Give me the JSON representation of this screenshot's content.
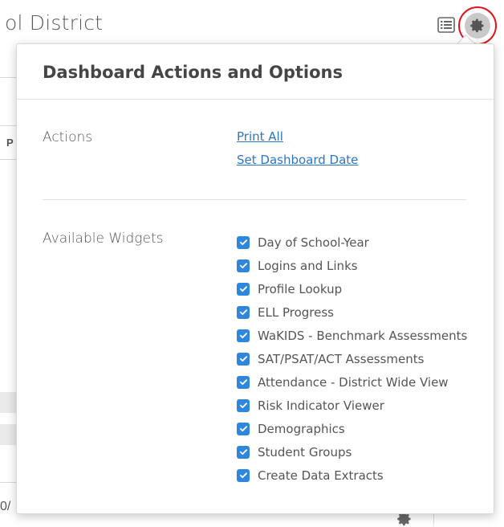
{
  "page": {
    "title_fragment": "ol District",
    "left_edge_letter": "P",
    "bottom_text_fragment": "0/"
  },
  "header": {
    "list_view_icon": "list-view-icon",
    "settings_icon": "gear-icon"
  },
  "popover": {
    "title": "Dashboard Actions and Options",
    "actions": {
      "label": "Actions",
      "links": [
        "Print All",
        "Set Dashboard Date"
      ]
    },
    "widgets": {
      "label": "Available Widgets",
      "items": [
        {
          "label": "Day of School-Year",
          "checked": true
        },
        {
          "label": "Logins and Links",
          "checked": true
        },
        {
          "label": "Profile Lookup",
          "checked": true
        },
        {
          "label": "ELL Progress",
          "checked": true
        },
        {
          "label": "WaKIDS - Benchmark Assessments",
          "checked": true
        },
        {
          "label": "SAT/PSAT/ACT Assessments",
          "checked": true
        },
        {
          "label": "Attendance - District Wide View",
          "checked": true
        },
        {
          "label": "Risk Indicator Viewer",
          "checked": true
        },
        {
          "label": "Demographics",
          "checked": true
        },
        {
          "label": "Student Groups",
          "checked": true
        },
        {
          "label": "Create Data Extracts",
          "checked": true
        }
      ]
    }
  },
  "colors": {
    "checkbox": "#2e86de",
    "link": "#2e76c4",
    "highlight_ring": "#e0141e"
  }
}
